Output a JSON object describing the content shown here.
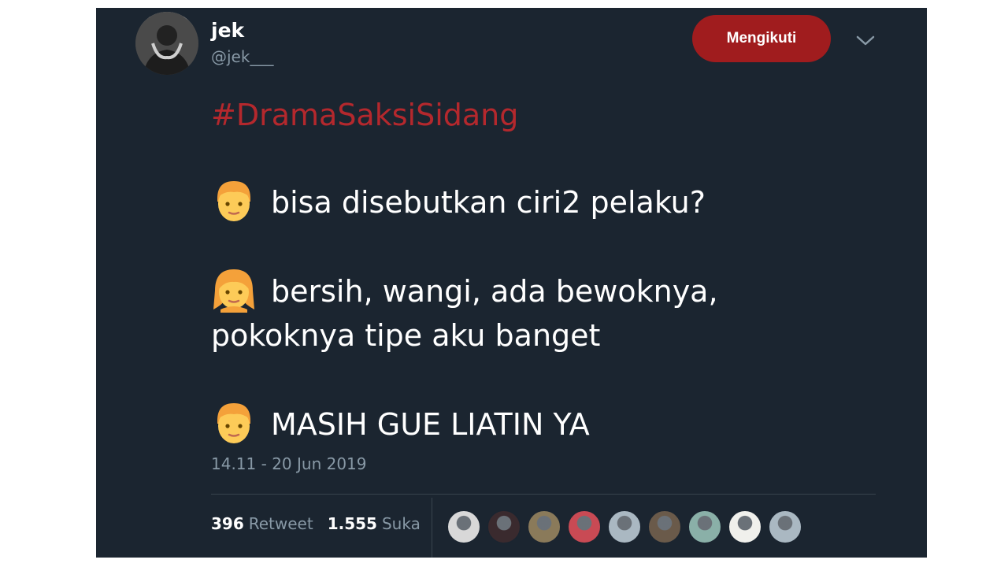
{
  "tweet": {
    "display_name": "jek",
    "handle": "@jek___",
    "follow_label": "Mengikuti",
    "hashtag": "#DramaSaksiSidang",
    "lines": {
      "l1": "bisa disebutkan ciri2 pelaku?",
      "l2a": "bersih, wangi, ada bewoknya,",
      "l2b": "pokoknya tipe aku banget",
      "l3": "MASIH GUE LIATIN YA"
    },
    "timestamp": "14.11 - 20 Jun 2019",
    "retweets": "396",
    "retweets_label": "Retweet",
    "likes": "1.555",
    "likes_label": "Suka"
  },
  "icons": {
    "avatar": "user-avatar",
    "menu": "chevron-down-icon",
    "emoji_man": "man-emoji",
    "emoji_woman": "woman-emoji"
  },
  "colors": {
    "background": "#1b2530",
    "accent": "#a01c1e",
    "hashtag": "#b4282d",
    "muted": "#8899a6"
  },
  "likers": [
    {
      "color": "#d8d8d8"
    },
    {
      "color": "#3a2a2e"
    },
    {
      "color": "#8a7a5a"
    },
    {
      "color": "#c94a54"
    },
    {
      "color": "#aab8c2"
    },
    {
      "color": "#6a5a4a"
    },
    {
      "color": "#8ab0a8"
    },
    {
      "color": "#f0f0ec"
    },
    {
      "color": "#aab8c2"
    }
  ]
}
